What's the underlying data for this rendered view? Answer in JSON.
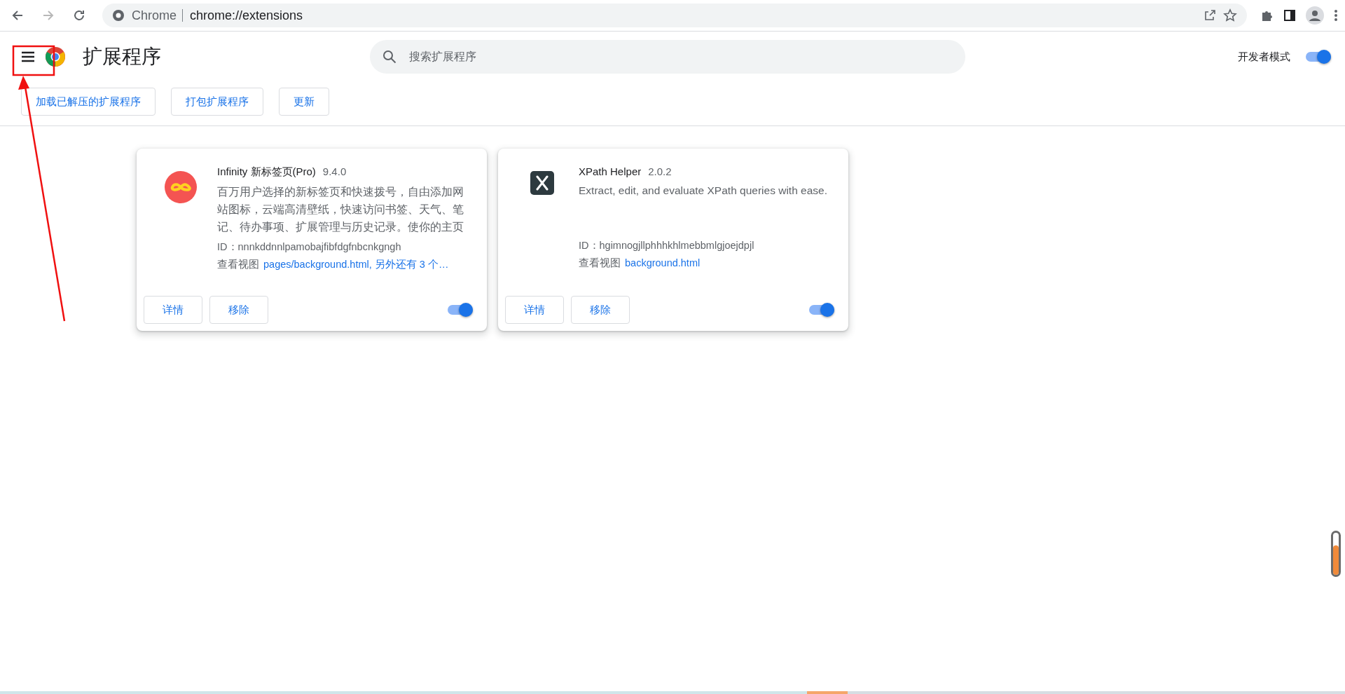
{
  "browser": {
    "site_label": "Chrome",
    "url": "chrome://extensions"
  },
  "header": {
    "title": "扩展程序",
    "search": {
      "placeholder": "搜索扩展程序"
    },
    "dev_mode": {
      "label": "开发者模式",
      "on": true
    }
  },
  "actions": [
    "加载已解压的扩展程序",
    "打包扩展程序",
    "更新"
  ],
  "extensions": [
    {
      "kind": "infinity",
      "name": "Infinity 新标签页(Pro)",
      "version": "9.4.0",
      "description": "百万用户选择的新标签页和快速拨号，自由添加网站图标，云端高清壁纸，快速访问书签、天气、笔记、待办事项、扩展管理与历史记录。使你的主页",
      "id": "ID：nnnkddnnlpamobajfibfdgfnbcnkgngh",
      "views_label": "查看视图",
      "views_link": "pages/background.html, 另外还有 3 个…",
      "details": "详情",
      "remove": "移除",
      "on": true
    },
    {
      "kind": "xpath",
      "name": "XPath Helper",
      "version": "2.0.2",
      "description": "Extract, edit, and evaluate XPath queries with ease.",
      "id": "ID：hgimnogjllphhhkhlmebbmlgjoejdpjl",
      "views_label": "查看视图",
      "views_link": "background.html",
      "details": "详情",
      "remove": "移除",
      "on": true
    }
  ],
  "side_meter": {
    "level": 0.7
  }
}
